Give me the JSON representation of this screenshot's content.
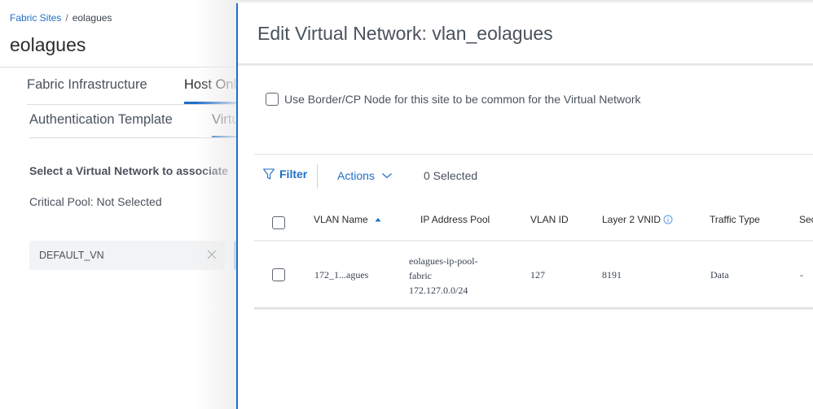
{
  "background_page": {
    "breadcrumb": {
      "parent": "Fabric Sites",
      "separator": "/",
      "current": "eolagues"
    },
    "title": "eolagues",
    "primary_tabs": [
      {
        "label": "Fabric Infrastructure",
        "active": false
      },
      {
        "label": "Host Onl",
        "active": true
      }
    ],
    "secondary_tabs": [
      {
        "label": "Authentication Template",
        "active": false
      },
      {
        "label": "Virtu",
        "active": true
      }
    ],
    "select_vn_label": "Select a Virtual Network to associate",
    "critical_pool": "Critical Pool: Not Selected",
    "selected_vn": {
      "label": "DEFAULT_VN",
      "remove_icon": "close-icon"
    }
  },
  "drawer": {
    "title": "Edit Virtual Network: vlan_eolagues",
    "common_border_checkbox": {
      "label": "Use Border/CP Node for this site to be common for the Virtual Network",
      "checked": false
    },
    "toolbar": {
      "filter_label": "Filter",
      "filter_icon": "filter-icon",
      "actions_label": "Actions",
      "actions_icon": "chevron-down-icon",
      "selected_count": "0 Selected"
    },
    "table": {
      "columns": [
        {
          "label": "VLAN Name",
          "sorted": "ascending"
        },
        {
          "label": "IP Address Pool"
        },
        {
          "label": "VLAN ID"
        },
        {
          "label": "Layer 2 VNID",
          "info_icon": "info-icon"
        },
        {
          "label": "Traffic Type"
        },
        {
          "label": "Sec"
        }
      ],
      "rows": [
        {
          "checked": false,
          "vlan_name": "172_1...agues",
          "ip_pool_line1": "eolagues-ip-pool-",
          "ip_pool_line2": "fabric",
          "ip_pool_line3": "172.127.0.0/24",
          "vlan_id": "127",
          "l2_vnid": "8191",
          "traffic_type": "Data",
          "sec": "-"
        }
      ]
    }
  },
  "colors": {
    "accent": "#1e6fc8",
    "text": "#39424e",
    "chip_bg": "#f2f3f4"
  }
}
